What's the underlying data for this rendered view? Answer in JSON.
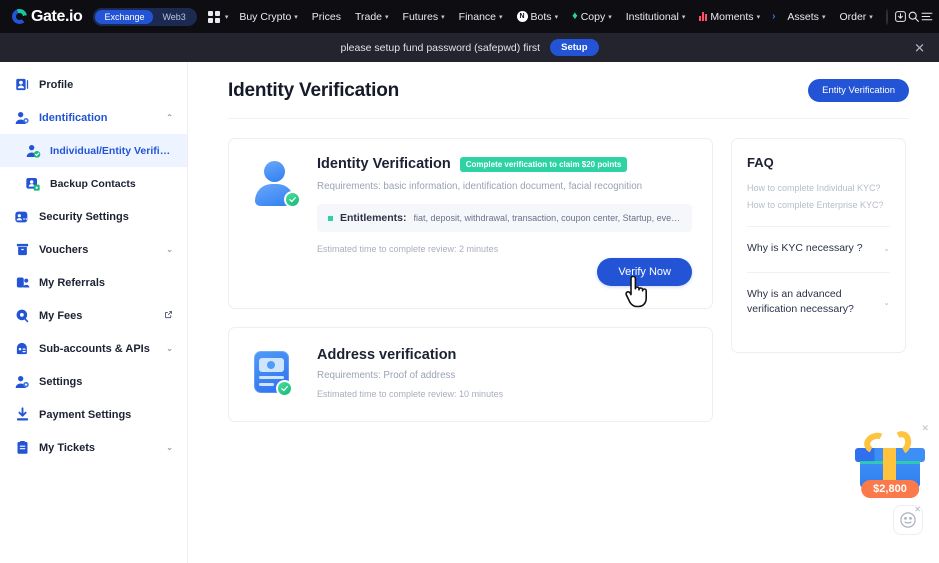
{
  "topnav": {
    "brand": "Gate.io",
    "segments": [
      {
        "label": "Exchange",
        "active": true
      },
      {
        "label": "Web3",
        "active": false
      }
    ],
    "items": [
      {
        "label": "Buy Crypto",
        "caret": true,
        "icon": ""
      },
      {
        "label": "Prices",
        "caret": false,
        "icon": ""
      },
      {
        "label": "Trade",
        "caret": true,
        "icon": ""
      },
      {
        "label": "Futures",
        "caret": true,
        "icon": ""
      },
      {
        "label": "Finance",
        "caret": true,
        "icon": ""
      },
      {
        "label": "Bots",
        "caret": true,
        "icon": "bots-icon"
      },
      {
        "label": "Copy",
        "caret": true,
        "icon": "copy-icon"
      },
      {
        "label": "Institutional",
        "caret": true,
        "icon": ""
      },
      {
        "label": "Moments",
        "caret": true,
        "icon": "moments-icon"
      }
    ],
    "more_arrow": "›",
    "right_items": [
      {
        "label": "Assets",
        "caret": true
      },
      {
        "label": "Order",
        "caret": true
      }
    ]
  },
  "banner": {
    "text": "please setup fund password (safepwd) first",
    "button": "Setup",
    "close": "✕"
  },
  "sidebar": {
    "items": [
      {
        "label": "Profile",
        "icon": "profile-icon",
        "level": 0,
        "state": "normal",
        "chev": "",
        "ext": false
      },
      {
        "label": "Identification",
        "icon": "identification-icon",
        "level": 0,
        "state": "accent",
        "chev": "⌃",
        "ext": false
      },
      {
        "label": "Individual/Entity Verification",
        "icon": "individual-verification-icon",
        "level": 1,
        "state": "active",
        "chev": "",
        "ext": false
      },
      {
        "label": "Backup Contacts",
        "icon": "backup-contacts-icon",
        "level": 1,
        "state": "normal",
        "chev": "",
        "ext": false
      },
      {
        "label": "Security Settings",
        "icon": "security-settings-icon",
        "level": 0,
        "state": "normal",
        "chev": "",
        "ext": false
      },
      {
        "label": "Vouchers",
        "icon": "vouchers-icon",
        "level": 0,
        "state": "normal",
        "chev": "⌄",
        "ext": false
      },
      {
        "label": "My Referrals",
        "icon": "referrals-icon",
        "level": 0,
        "state": "normal",
        "chev": "",
        "ext": false
      },
      {
        "label": "My Fees",
        "icon": "fees-icon",
        "level": 0,
        "state": "normal",
        "chev": "",
        "ext": true
      },
      {
        "label": "Sub-accounts & APIs",
        "icon": "subaccounts-icon",
        "level": 0,
        "state": "normal",
        "chev": "⌄",
        "ext": false
      },
      {
        "label": "Settings",
        "icon": "settings-icon",
        "level": 0,
        "state": "normal",
        "chev": "",
        "ext": false
      },
      {
        "label": "Payment Settings",
        "icon": "payment-settings-icon",
        "level": 0,
        "state": "normal",
        "chev": "",
        "ext": false
      },
      {
        "label": "My Tickets",
        "icon": "tickets-icon",
        "level": 0,
        "state": "normal",
        "chev": "⌄",
        "ext": false
      }
    ]
  },
  "page": {
    "title": "Identity Verification",
    "entity_button": "Entity Verification"
  },
  "kyc_card": {
    "title": "Identity Verification",
    "badge": "Complete verification to claim $20 points",
    "requirements": "Requirements: basic information, identification document, facial recognition",
    "entitlements_label": "Entitlements:",
    "entitlements_text": "fiat, deposit, withdrawal, transaction, coupon center, Startup, event rewards, etc.",
    "estimate": "Estimated time to complete review: 2 minutes",
    "verify_button": "Verify Now"
  },
  "address_card": {
    "title": "Address verification",
    "requirements": "Requirements: Proof of address",
    "estimate": "Estimated time to complete review: 10 minutes"
  },
  "faq": {
    "title": "FAQ",
    "links": [
      "How to complete Individual KYC?",
      "How to complete Enterprise KYC?"
    ],
    "questions": [
      {
        "q": "Why is KYC necessary ?",
        "chev": "⌄"
      },
      {
        "q": "Why is an advanced verification necessary?",
        "chev": "⌄"
      }
    ]
  },
  "gift": {
    "amount": "$2,800",
    "close": "✕",
    "smiley_close": "✕"
  },
  "colors": {
    "brand_blue": "#2354d6",
    "teal": "#2ed3a4",
    "nav_black": "#0d0d12",
    "banner_dark": "#24242f",
    "orange": "#fb7a4b"
  }
}
